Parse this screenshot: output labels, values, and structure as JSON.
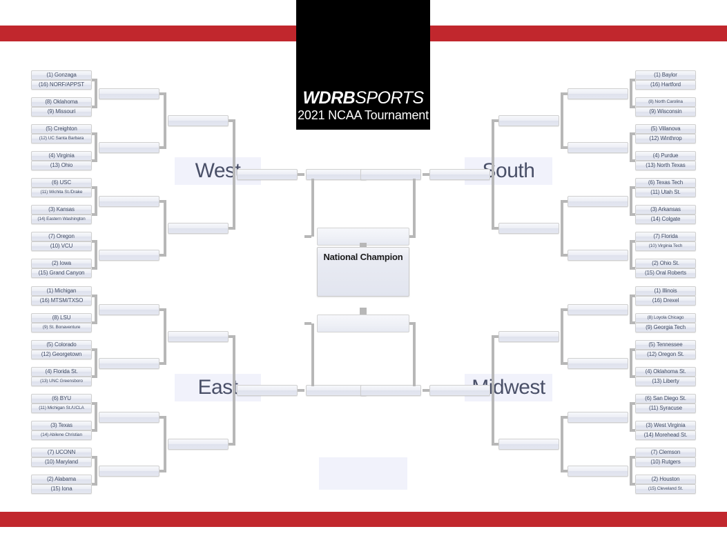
{
  "header": {
    "logo_primary": "WDRB",
    "logo_secondary": "SPORTS",
    "logo_subtitle": "2021 NCAA Tournament",
    "accent_color": "#c1272d",
    "logo_bg_color": "#000000"
  },
  "center": {
    "champion_label": "National Champion",
    "final_four_top": "",
    "final_four_bottom": ""
  },
  "regions": [
    {
      "name": "West",
      "side": "left",
      "label": "West",
      "teams": [
        {
          "seed": "1",
          "name": "Gonzaga",
          "display": "(1) Gonzaga"
        },
        {
          "seed": "16",
          "name": "NORF/APPST",
          "display": "(16) NORF/APPST"
        },
        {
          "seed": "8",
          "name": "Oklahoma",
          "display": "(8) Oklahoma"
        },
        {
          "seed": "9",
          "name": "Missouri",
          "display": "(9) Missouri"
        },
        {
          "seed": "5",
          "name": "Creighton",
          "display": "(5) Creighton"
        },
        {
          "seed": "12",
          "name": "UC Santa Barbara",
          "display": "(12) UC Santa Barbara"
        },
        {
          "seed": "4",
          "name": "Virginia",
          "display": "(4) Virginia"
        },
        {
          "seed": "13",
          "name": "Ohio",
          "display": "(13) Ohio"
        },
        {
          "seed": "6",
          "name": "USC",
          "display": "(6) USC"
        },
        {
          "seed": "11",
          "name": "Wichita St./Drake",
          "display": "(11) Wichita St./Drake"
        },
        {
          "seed": "3",
          "name": "Kansas",
          "display": "(3) Kansas"
        },
        {
          "seed": "14",
          "name": "Eastern Washington",
          "display": "(14) Eastern Washington"
        },
        {
          "seed": "7",
          "name": "Oregon",
          "display": "(7) Oregon"
        },
        {
          "seed": "10",
          "name": "VCU",
          "display": "(10) VCU"
        },
        {
          "seed": "2",
          "name": "Iowa",
          "display": "(2) Iowa"
        },
        {
          "seed": "15",
          "name": "Grand Canyon",
          "display": "(15) Grand Canyon"
        }
      ]
    },
    {
      "name": "East",
      "side": "left",
      "label": "East",
      "teams": [
        {
          "seed": "1",
          "name": "Michigan",
          "display": "(1) Michigan"
        },
        {
          "seed": "16",
          "name": "MTSM/TXSO",
          "display": "(16) MTSM/TXSO"
        },
        {
          "seed": "8",
          "name": "LSU",
          "display": "(8) LSU"
        },
        {
          "seed": "9",
          "name": "St. Bonaventure",
          "display": "(9) St. Bonaventure"
        },
        {
          "seed": "5",
          "name": "Colorado",
          "display": "(5) Colorado"
        },
        {
          "seed": "12",
          "name": "Georgetown",
          "display": "(12) Georgetown"
        },
        {
          "seed": "4",
          "name": "Florida St.",
          "display": "(4) Florida St."
        },
        {
          "seed": "13",
          "name": "UNC Greensboro",
          "display": "(13) UNC Greensboro"
        },
        {
          "seed": "6",
          "name": "BYU",
          "display": "(6) BYU"
        },
        {
          "seed": "11",
          "name": "Michigan St./UCLA",
          "display": "(11) Michigan St./UCLA"
        },
        {
          "seed": "3",
          "name": "Texas",
          "display": "(3) Texas"
        },
        {
          "seed": "14",
          "name": "Abilene Christian",
          "display": "(14) Abilene Christian"
        },
        {
          "seed": "7",
          "name": "UCONN",
          "display": "(7) UCONN"
        },
        {
          "seed": "10",
          "name": "Maryland",
          "display": "(10) Maryland"
        },
        {
          "seed": "2",
          "name": "Alabama",
          "display": "(2) Alabama"
        },
        {
          "seed": "15",
          "name": "Iona",
          "display": "(15) Iona"
        }
      ]
    },
    {
      "name": "South",
      "side": "right",
      "label": "South",
      "teams": [
        {
          "seed": "1",
          "name": "Baylor",
          "display": "(1) Baylor"
        },
        {
          "seed": "16",
          "name": "Hartford",
          "display": "(16) Hartford"
        },
        {
          "seed": "8",
          "name": "North Carolina",
          "display": "(8) North Carolina"
        },
        {
          "seed": "9",
          "name": "Wisconsin",
          "display": "(9) Wisconsin"
        },
        {
          "seed": "5",
          "name": "Villanova",
          "display": "(5) Villanova"
        },
        {
          "seed": "12",
          "name": "Winthrop",
          "display": "(12) Winthrop"
        },
        {
          "seed": "4",
          "name": "Purdue",
          "display": "(4) Purdue"
        },
        {
          "seed": "13",
          "name": "North Texas",
          "display": "(13) North Texas"
        },
        {
          "seed": "6",
          "name": "Texas Tech",
          "display": "(6) Texas Tech"
        },
        {
          "seed": "11",
          "name": "Utah St.",
          "display": "(11) Utah St."
        },
        {
          "seed": "3",
          "name": "Arkansas",
          "display": "(3) Arkansas"
        },
        {
          "seed": "14",
          "name": "Colgate",
          "display": "(14) Colgate"
        },
        {
          "seed": "7",
          "name": "Florida",
          "display": "(7) Florida"
        },
        {
          "seed": "10",
          "name": "Virginia Tech",
          "display": "(10) Virginia Tech"
        },
        {
          "seed": "2",
          "name": "Ohio St.",
          "display": "(2) Ohio St."
        },
        {
          "seed": "15",
          "name": "Oral Roberts",
          "display": "(15) Oral Roberts"
        }
      ]
    },
    {
      "name": "Midwest",
      "side": "right",
      "label": "Midwest",
      "teams": [
        {
          "seed": "1",
          "name": "Illinois",
          "display": "(1) Illinois"
        },
        {
          "seed": "16",
          "name": "Drexel",
          "display": "(16) Drexel"
        },
        {
          "seed": "8",
          "name": "Loyola Chicago",
          "display": "(8) Loyola Chicago"
        },
        {
          "seed": "9",
          "name": "Georgia Tech",
          "display": "(9) Georgia Tech"
        },
        {
          "seed": "5",
          "name": "Tennessee",
          "display": "(5) Tennessee"
        },
        {
          "seed": "12",
          "name": "Oregon St.",
          "display": "(12) Oregon St."
        },
        {
          "seed": "4",
          "name": "Oklahoma St.",
          "display": "(4) Oklahoma St."
        },
        {
          "seed": "13",
          "name": "Liberty",
          "display": "(13) Liberty"
        },
        {
          "seed": "6",
          "name": "San Diego St.",
          "display": "(6) San Diego St."
        },
        {
          "seed": "11",
          "name": "Syracuse",
          "display": "(11) Syracuse"
        },
        {
          "seed": "3",
          "name": "West Virginia",
          "display": "(3) West Virginia"
        },
        {
          "seed": "14",
          "name": "Morehead St.",
          "display": "(14) Morehead St."
        },
        {
          "seed": "7",
          "name": "Clemson",
          "display": "(7) Clemson"
        },
        {
          "seed": "10",
          "name": "Rutgers",
          "display": "(10) Rutgers"
        },
        {
          "seed": "2",
          "name": "Houston",
          "display": "(2) Houston"
        },
        {
          "seed": "15",
          "name": "Cleveland St.",
          "display": "(15) Cleveland St."
        }
      ]
    }
  ]
}
